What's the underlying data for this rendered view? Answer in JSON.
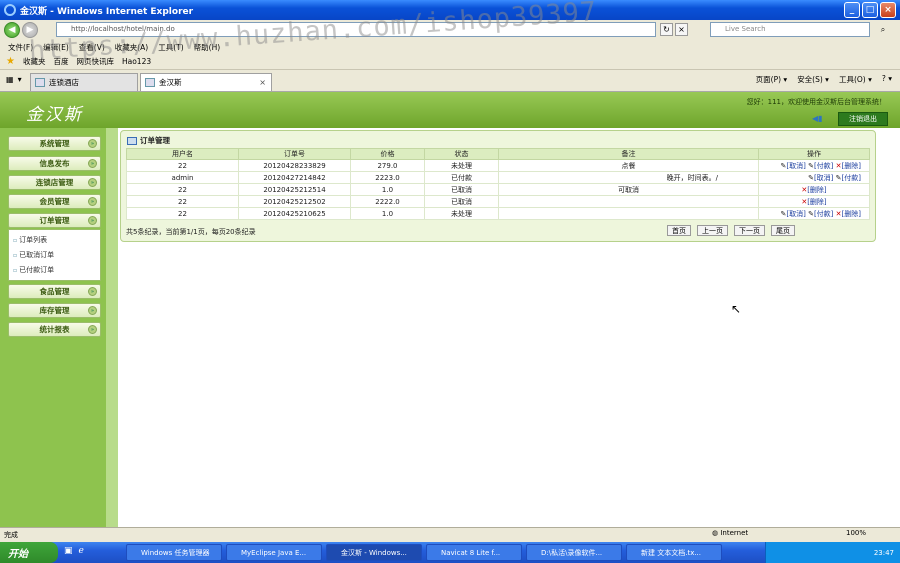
{
  "window": {
    "title": "金汉斯 - Windows Internet Explorer",
    "min": "_",
    "max": "□",
    "close": "×"
  },
  "address": {
    "url": "http://localhost/hotel/main.do",
    "search_placeholder": "Live Search",
    "back": "◀",
    "forward": "▶",
    "refresh": "↻",
    "stop": "×",
    "go": "⌕"
  },
  "menu": [
    "文件(F)",
    "编辑(E)",
    "查看(V)",
    "收藏夹(A)",
    "工具(T)",
    "帮助(H)"
  ],
  "favorites": {
    "label": "收藏夹",
    "items": [
      "百度",
      "网页快讯库",
      "Hao123"
    ]
  },
  "tabs": [
    {
      "label": "连锁酒店"
    },
    {
      "label": "金汉斯"
    }
  ],
  "commands": [
    "页面(P) ▾",
    "安全(S) ▾",
    "工具(O) ▾",
    "? ▾"
  ],
  "header": {
    "logo": "金汉斯",
    "welcome": "您好：111，欢迎使用金汉斯后台管理系统！",
    "logout": "注销退出"
  },
  "sidebar": {
    "items": [
      "系统管理",
      "信息发布",
      "连锁店管理",
      "会员管理",
      "订单管理",
      "食品管理",
      "库存管理",
      "统计报表"
    ],
    "sub": [
      "订单列表",
      "已取消订单",
      "已付款订单"
    ]
  },
  "content": {
    "title": "订单管理",
    "columns": [
      "用户名",
      "订单号",
      "价格",
      "状态",
      "备注",
      "操作"
    ],
    "rows": [
      {
        "user": "22",
        "order": "20120428233829",
        "price": "279.0",
        "status": "未处理",
        "note": "点餐",
        "ops": [
          "[取消]",
          "[付款]",
          "[删除]"
        ]
      },
      {
        "user": "admin",
        "order": "20120427214842",
        "price": "2223.0",
        "status": "已付款",
        "note": "晚开，时间表。/",
        "ops": [
          "[取消]",
          "[付款]"
        ]
      },
      {
        "user": "22",
        "order": "20120425212514",
        "price": "1.0",
        "status": "已取消",
        "note": "可取消",
        "ops": [
          "[删除]"
        ]
      },
      {
        "user": "22",
        "order": "20120425212502",
        "price": "2222.0",
        "status": "已取消",
        "note": "",
        "ops": [
          "[删除]"
        ]
      },
      {
        "user": "22",
        "order": "20120425210625",
        "price": "1.0",
        "status": "未处理",
        "note": "",
        "ops": [
          "[取消]",
          "[付款]",
          "[删除]"
        ]
      }
    ],
    "footer": "共5条纪录，当前第1/1页，每页20条纪录",
    "pager": [
      "首页",
      "上一页",
      "下一页",
      "尾页"
    ]
  },
  "watermark": "https://www.huzhan.com/ishop39397",
  "status": {
    "left": "完成",
    "zone": "Internet",
    "zoom": "100%"
  },
  "taskbar": {
    "start": "开始",
    "tasks": [
      "Windows 任务管理器",
      "MyEclipse Java E...",
      "金汉斯 - Windows...",
      "Navicat 8 Lite f...",
      "D:\\私活\\录像软件...",
      "新建 文本文档.tx..."
    ],
    "clock": "23:47"
  }
}
